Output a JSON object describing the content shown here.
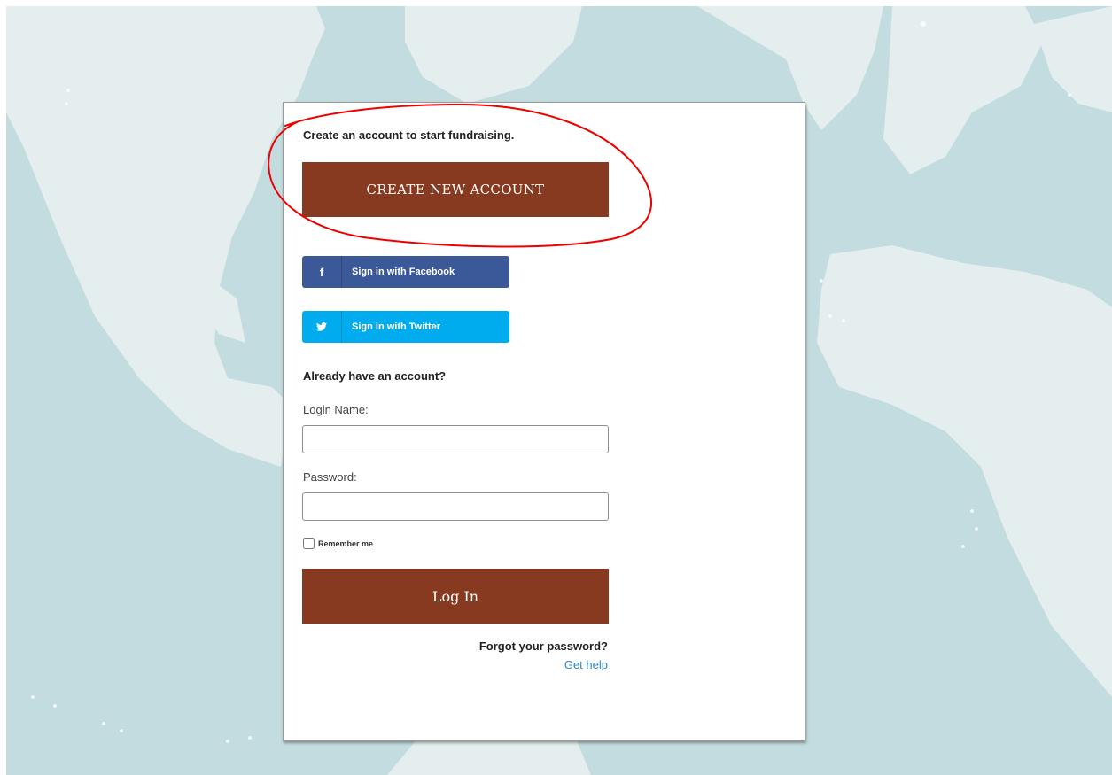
{
  "intro": {
    "text": "Create an account to start fundraising."
  },
  "create_button": {
    "label": "CREATE NEW ACCOUNT"
  },
  "social": {
    "facebook": {
      "icon": "f",
      "label": "Sign in with Facebook",
      "color": "#3b5998"
    },
    "twitter": {
      "icon": "🐦",
      "label": "Sign in with Twitter",
      "color": "#00acee"
    }
  },
  "login": {
    "heading": "Already have an account?",
    "login_name_label": "Login Name:",
    "login_name_value": "",
    "password_label": "Password:",
    "password_value": "",
    "remember_label": "Remember me",
    "button_label": "Log In"
  },
  "help": {
    "forgot_text": "Forgot your password?",
    "get_help_link": "Get help"
  },
  "colors": {
    "brand_brown": "#883a21",
    "map_water": "#c3dcdf",
    "map_land": "#e4eeee",
    "annotation_red": "#ee0000",
    "link_blue": "#2f86c7"
  }
}
